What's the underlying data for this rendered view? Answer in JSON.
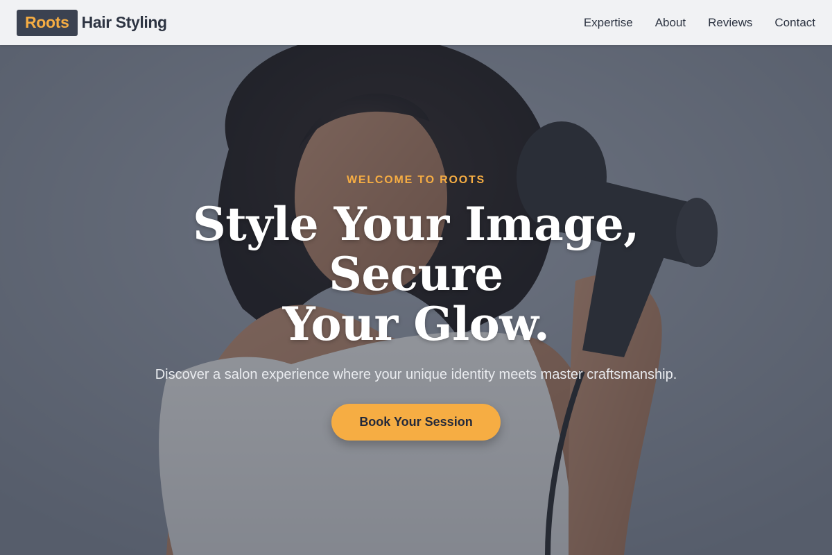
{
  "header": {
    "logo_box": "Roots",
    "logo_text": "Hair Styling",
    "nav": [
      "Expertise",
      "About",
      "Reviews",
      "Contact"
    ]
  },
  "hero": {
    "eyebrow": "WELCOME TO ROOTS",
    "headline_line1": "Style Your Image, Secure",
    "headline_line2": "Your Glow.",
    "subtext": "Discover a salon experience where your unique identity meets master craftsmanship.",
    "cta_label": "Book Your Session",
    "background_image": "woman with curly hair holding hair dryer"
  },
  "colors": {
    "accent": "#f6ad43",
    "dark": "#3b4251",
    "header_bg": "#f1f2f4"
  }
}
